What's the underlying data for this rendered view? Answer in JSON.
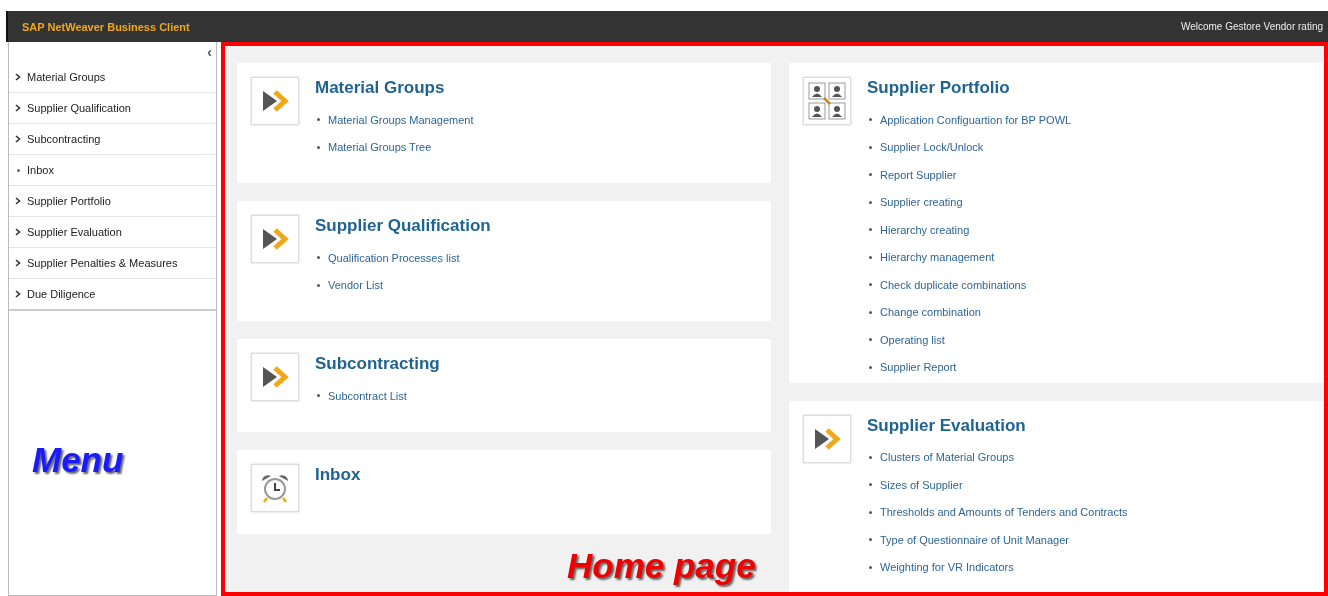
{
  "header": {
    "title": "SAP NetWeaver Business Client",
    "welcome": "Welcome Gestore Vendor rating"
  },
  "sidebar": {
    "collapse": "‹",
    "items": [
      {
        "label": "Material Groups",
        "expandable": true
      },
      {
        "label": "Supplier Qualification",
        "expandable": true
      },
      {
        "label": "Subcontracting",
        "expandable": true
      },
      {
        "label": "Inbox",
        "expandable": false
      },
      {
        "label": "Supplier Portfolio",
        "expandable": true
      },
      {
        "label": "Supplier Evaluation",
        "expandable": true
      },
      {
        "label": "Supplier Penalties & Measures",
        "expandable": true
      },
      {
        "label": "Due Diligence",
        "expandable": true
      }
    ]
  },
  "columns": [
    [
      {
        "title": "Material Groups",
        "kind": "arrows",
        "links": [
          "Material Groups Management",
          "Material Groups Tree"
        ]
      },
      {
        "title": "Supplier Qualification",
        "kind": "arrows",
        "links": [
          "Qualification Processes list",
          "Vendor List"
        ]
      },
      {
        "title": "Subcontracting",
        "kind": "arrows",
        "links": [
          "Subcontract List"
        ]
      },
      {
        "title": "Inbox",
        "kind": "alarm"
      }
    ],
    [
      {
        "title": "Supplier Portfolio",
        "kind": "people",
        "links": [
          "Application Configuartion for BP POWL",
          "Supplier Lock/Unlock",
          "Report Supplier",
          "Supplier creating",
          "Hierarchy creating",
          "Hierarchy management",
          "Check duplicate combinations",
          "Change combination",
          "Operating list",
          "Supplier Report"
        ]
      },
      {
        "title": "Supplier Evaluation",
        "kind": "arrows",
        "links": [
          "Clusters of Material Groups",
          "Sizes of Supplier",
          "Thresholds and Amounts of Tenders and Contracts",
          "Type of Questionnaire of Unit Manager",
          "Weighting for VR Indicators"
        ]
      }
    ]
  ],
  "annotations": {
    "menu": "Menu",
    "home": "Home page"
  }
}
